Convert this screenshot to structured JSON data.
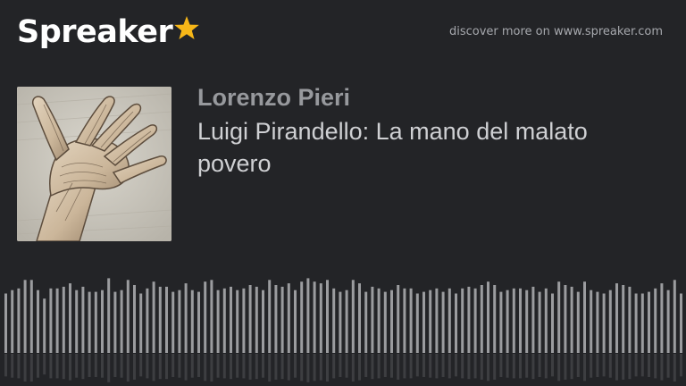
{
  "header": {
    "logo_text": "Spreaker",
    "logo_star_icon": "star-icon",
    "logo_star_color": "#f7b718",
    "tagline": "discover more on www.spreaker.com"
  },
  "episode": {
    "author": "Lorenzo Pieri",
    "title": "Luigi Pirandello: La mano del malato povero",
    "cover_icon": "hand-drawing-icon"
  },
  "colors": {
    "background": "#232427",
    "waveform": "#9b9c9f"
  },
  "waveform": {
    "bars": [
      0.7,
      0.74,
      0.76,
      0.86,
      0.86,
      0.74,
      0.64,
      0.76,
      0.76,
      0.78,
      0.82,
      0.74,
      0.78,
      0.72,
      0.72,
      0.74,
      0.88,
      0.72,
      0.74,
      0.86,
      0.8,
      0.7,
      0.76,
      0.84,
      0.78,
      0.78,
      0.72,
      0.74,
      0.82,
      0.74,
      0.72,
      0.84,
      0.86,
      0.74,
      0.76,
      0.78,
      0.74,
      0.76,
      0.8,
      0.78,
      0.74,
      0.86,
      0.8,
      0.78,
      0.82,
      0.74,
      0.84,
      0.88,
      0.84,
      0.82,
      0.86,
      0.76,
      0.72,
      0.74,
      0.86,
      0.82,
      0.72,
      0.78,
      0.76,
      0.72,
      0.74,
      0.8,
      0.76,
      0.76,
      0.7,
      0.72,
      0.74,
      0.76,
      0.72,
      0.76,
      0.7,
      0.76,
      0.78,
      0.76,
      0.8,
      0.84,
      0.8,
      0.72,
      0.74,
      0.76,
      0.76,
      0.74,
      0.78,
      0.72,
      0.76,
      0.7,
      0.84,
      0.8,
      0.78,
      0.72,
      0.84,
      0.74,
      0.72,
      0.7,
      0.74,
      0.82,
      0.8,
      0.78,
      0.7,
      0.7,
      0.72,
      0.76,
      0.82,
      0.74,
      0.86,
      0.7,
      0.74,
      0.78
    ]
  }
}
